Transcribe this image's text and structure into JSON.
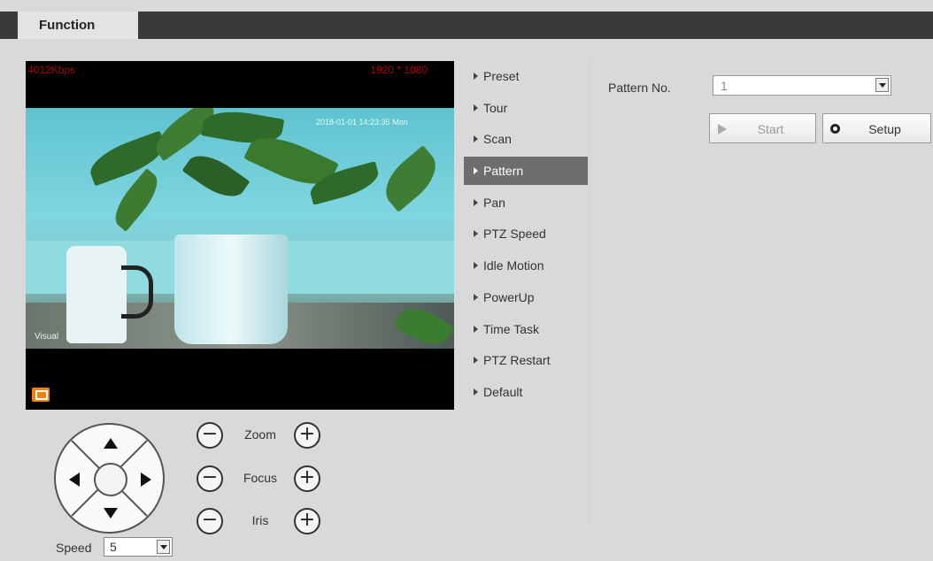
{
  "tabs": {
    "function_label": "Function"
  },
  "video": {
    "bitrate": "4012Kbps",
    "resolution": "1920 * 1080",
    "osd_time": "2018-01-01 14:23:35 Mon",
    "scene_label": "Visual"
  },
  "controls": {
    "zoom_label": "Zoom",
    "focus_label": "Focus",
    "iris_label": "Iris",
    "minus_symbol": "−",
    "plus_symbol": "+",
    "speed_label": "Speed",
    "speed_value": "5"
  },
  "menu": {
    "items": [
      {
        "label": "Preset"
      },
      {
        "label": "Tour"
      },
      {
        "label": "Scan"
      },
      {
        "label": "Pattern"
      },
      {
        "label": "Pan"
      },
      {
        "label": "PTZ Speed"
      },
      {
        "label": "Idle Motion"
      },
      {
        "label": "PowerUp"
      },
      {
        "label": "Time Task"
      },
      {
        "label": "PTZ Restart"
      },
      {
        "label": "Default"
      }
    ],
    "active": "Pattern"
  },
  "pattern": {
    "label": "Pattern No.",
    "value": "1",
    "start_label": "Start",
    "setup_label": "Setup"
  },
  "colors": {
    "accent_orange": "#f08010",
    "active_menu": "#6e6e6e",
    "osd_red": "#b40000"
  }
}
